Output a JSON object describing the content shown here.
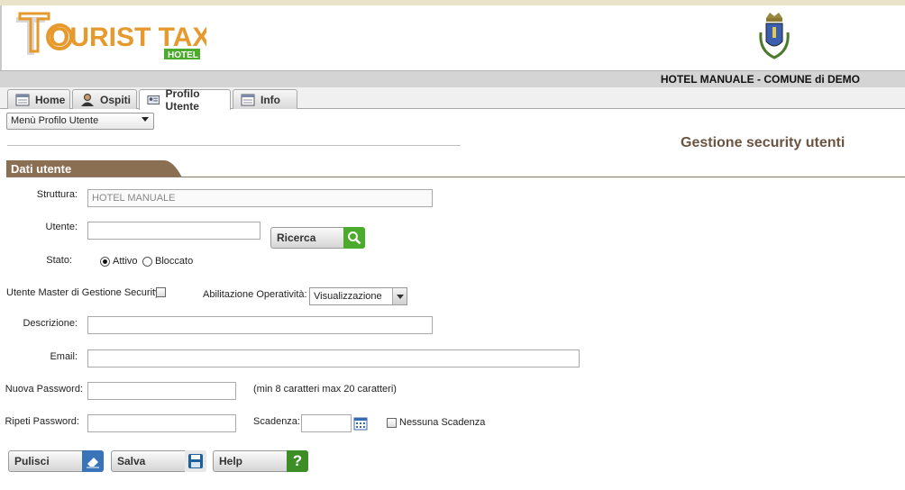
{
  "header": {
    "logo_text": "OURIST TAX",
    "logo_sub": "HOTEL",
    "hotel_name": "HOTEL MANUALE - COMUNE di DEMO"
  },
  "tabs": [
    {
      "label": "Home",
      "icon": "home-window-icon"
    },
    {
      "label": "Ospiti",
      "icon": "person-icon"
    },
    {
      "label": "Profilo Utente",
      "icon": "id-card-icon",
      "active": true
    },
    {
      "label": "Info",
      "icon": "info-window-icon"
    }
  ],
  "menu_select": {
    "value": "Menù Profilo Utente"
  },
  "page_title": "Gestione security utenti",
  "section_title": "Dati utente",
  "form": {
    "struttura_label": "Struttura:",
    "struttura_value": "HOTEL MANUALE",
    "utente_label": "Utente:",
    "utente_value": "",
    "ricerca_label": "Ricerca",
    "stato_label": "Stato:",
    "stato_options": [
      "Attivo",
      "Bloccato"
    ],
    "stato_selected": "Attivo",
    "master_label": "Utente Master di Gestione Security",
    "abilitazione_label": "Abilitazione Operatività:",
    "abilitazione_value": "Visualizzazione",
    "descrizione_label": "Descrizione:",
    "email_label": "Email:",
    "nuova_password_label": "Nuova Password:",
    "password_hint": "(min 8 caratteri max 20 caratteri)",
    "ripeti_password_label": "Ripeti Password:",
    "scadenza_label": "Scadenza:",
    "nessuna_scadenza_label": "Nessuna Scadenza"
  },
  "buttons": {
    "pulisci": "Pulisci",
    "salva": "Salva",
    "help": "Help"
  },
  "colors": {
    "brand_orange": "#e69a2e",
    "brand_green": "#4caa2c",
    "section_brown": "#8a6f52",
    "title_brown": "#6b5541"
  }
}
